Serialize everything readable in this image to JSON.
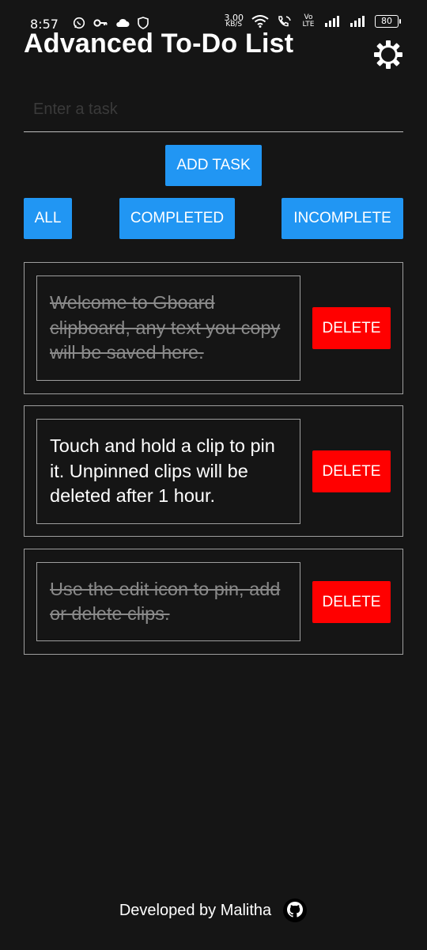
{
  "status_bar": {
    "time": "8:57",
    "speed_value": "3.00",
    "speed_unit": "KB/S",
    "volte": "Vo LTE",
    "battery": "80"
  },
  "header": {
    "title": "Advanced To-Do List",
    "settings_icon": "gear-icon"
  },
  "input": {
    "placeholder": "Enter a task",
    "value": ""
  },
  "actions": {
    "add_task_label": "ADD TASK"
  },
  "filters": {
    "all_label": "ALL",
    "completed_label": "COMPLETED",
    "incomplete_label": "INCOMPLETE"
  },
  "tasks": [
    {
      "text": "Welcome to Gboard clipboard, any text you copy will be saved here.",
      "completed": true,
      "delete_label": "DELETE"
    },
    {
      "text": "Touch and hold a clip to pin it. Unpinned clips will be deleted after 1 hour.",
      "completed": false,
      "delete_label": "DELETE"
    },
    {
      "text": "Use the edit icon to pin, add or delete clips.",
      "completed": true,
      "delete_label": "DELETE"
    }
  ],
  "footer": {
    "text": "Developed by Malitha",
    "icon": "github-icon"
  },
  "colors": {
    "background": "#151515",
    "primary": "#2196f3",
    "danger": "#ff0000",
    "completed_text": "#8a8a8a"
  }
}
